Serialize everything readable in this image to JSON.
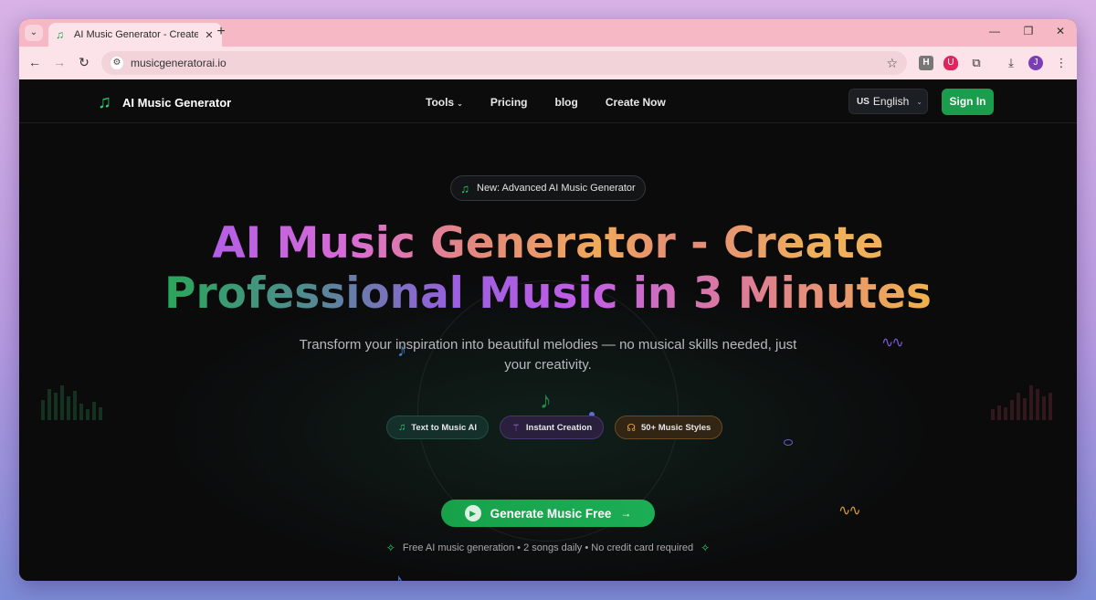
{
  "browser": {
    "tab_title": "AI Music Generator - Create Pro",
    "url": "musicgeneratorai.io",
    "profile_initial": "J",
    "ext_h": "H"
  },
  "nav": {
    "logo_text": "AI Music Generator",
    "links": [
      "Tools",
      "Pricing",
      "blog",
      "Create Now"
    ],
    "language_code": "US",
    "language": "English",
    "signin": "Sign In"
  },
  "hero": {
    "badge": "New: Advanced AI Music Generator",
    "headline_line1": "AI Music Generator - Create",
    "headline_line2": "Professional Music in 3 Minutes",
    "subtitle": "Transform your inspiration into beautiful melodies — no musical skills needed, just your creativity.",
    "chips": [
      "Text to Music AI",
      "Instant Creation",
      "50+ Music Styles"
    ],
    "cta": "Generate Music Free",
    "footnote": "Free AI music generation • 2 songs daily • No credit card required"
  },
  "colors": {
    "brand_green": "#1a9d4d",
    "accent_purple": "#b25ee6",
    "accent_orange": "#f0a95a"
  },
  "icons": {
    "logo": "music-note-icon",
    "badge": "music-notes-icon",
    "chip1": "music-note-icon",
    "chip2": "magic-wand-icon",
    "chip3": "headphones-icon",
    "cta": "play-icon"
  }
}
